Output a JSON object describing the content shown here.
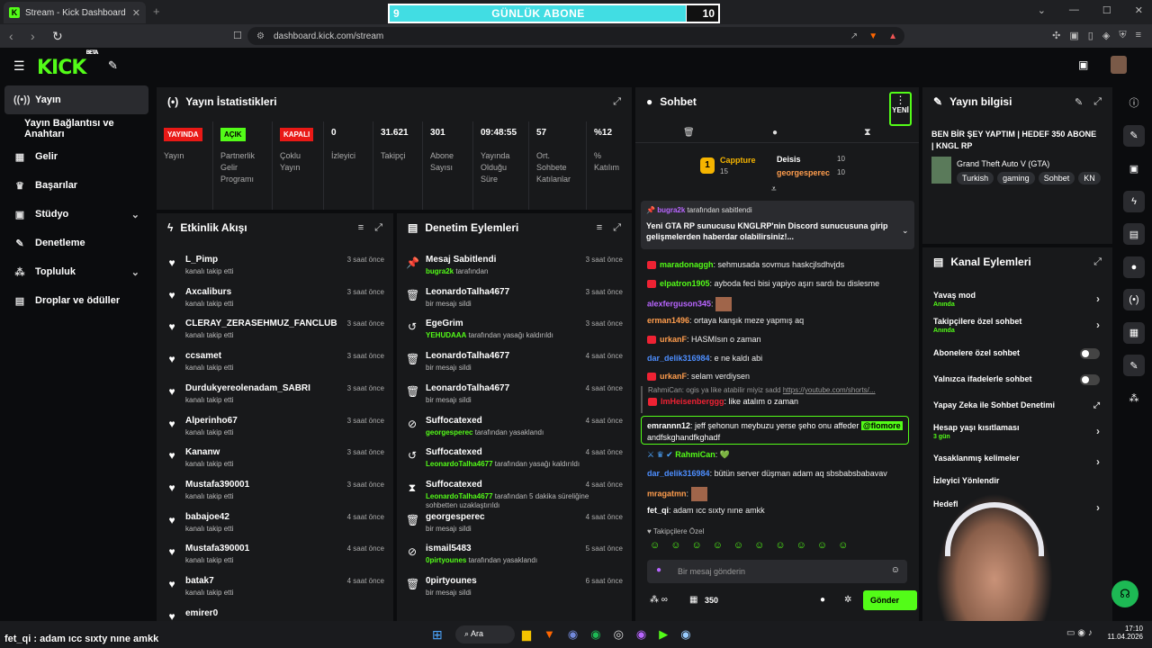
{
  "browser": {
    "tab_title": "Stream - Kick Dashboard",
    "url": "dashboard.kick.com/stream"
  },
  "goal": {
    "current": "9",
    "title": "GÜNLÜK ABONE",
    "target": "10",
    "progress": 0.9
  },
  "app": {
    "logo": "KICK",
    "beta": "BETA"
  },
  "sidebar": {
    "items": [
      {
        "label": "Yayın",
        "icon": "broadcast-icon"
      },
      {
        "label": "Yayın Bağlantısı ve Anahtarı",
        "icon": ""
      },
      {
        "label": "Gelir",
        "icon": "money-icon"
      },
      {
        "label": "Başarılar",
        "icon": "trophy-icon"
      },
      {
        "label": "Stüdyo",
        "icon": "studio-icon"
      },
      {
        "label": "Denetleme",
        "icon": "wrench-icon"
      },
      {
        "label": "Topluluk",
        "icon": "users-icon"
      },
      {
        "label": "Droplar ve ödüller",
        "icon": "gift-icon"
      }
    ]
  },
  "stats": {
    "title": "Yayın İstatistikleri",
    "items": [
      {
        "badge": "YAYINDA",
        "badge_color": "#e91916",
        "label": "Yayın"
      },
      {
        "badge": "AÇIK",
        "badge_color": "#53fc18",
        "label": "Partnerlik Gelir Programı"
      },
      {
        "badge": "KAPALI",
        "badge_color": "#e91916",
        "label": "Çoklu Yayın"
      },
      {
        "value": "0",
        "label": "İzleyici"
      },
      {
        "value": "31.621",
        "label": "Takipçi"
      },
      {
        "value": "301",
        "label": "Abone Sayısı"
      },
      {
        "value": "09:48:55",
        "label": "Yayında Olduğu Süre"
      },
      {
        "value": "57",
        "label": "Ort. Sohbete Katılanlar"
      },
      {
        "value": "%12",
        "label": "% Katılım"
      }
    ]
  },
  "activity": {
    "title": "Etkinlik Akışı",
    "rows": [
      {
        "name": "L_Pimp",
        "desc": "kanalı takip etti",
        "time": "3 saat önce"
      },
      {
        "name": "Axcaliburs",
        "desc": "kanalı takip etti",
        "time": "3 saat önce"
      },
      {
        "name": "CLERAY_ZERASEHMUZ_FANCLUB",
        "desc": "kanalı takip etti",
        "time": "3 saat önce"
      },
      {
        "name": "ccsamet",
        "desc": "kanalı takip etti",
        "time": "3 saat önce"
      },
      {
        "name": "Durdukyereolenadam_SABRI",
        "desc": "kanalı takip etti",
        "time": "3 saat önce"
      },
      {
        "name": "Alperinho67",
        "desc": "kanalı takip etti",
        "time": "3 saat önce"
      },
      {
        "name": "Kananw",
        "desc": "kanalı takip etti",
        "time": "3 saat önce"
      },
      {
        "name": "Mustafa390001",
        "desc": "kanalı takip etti",
        "time": "3 saat önce"
      },
      {
        "name": "babajoe42",
        "desc": "kanalı takip etti",
        "time": "4 saat önce"
      },
      {
        "name": "Mustafa390001",
        "desc": "kanalı takip etti",
        "time": "4 saat önce"
      },
      {
        "name": "batak7",
        "desc": "kanalı takip etti",
        "time": "4 saat önce"
      },
      {
        "name": "emirer0",
        "desc": "",
        "time": ""
      }
    ]
  },
  "mod": {
    "title": "Denetim Eylemleri",
    "rows": [
      {
        "name": "Mesaj Sabitlendi",
        "who": "bugra2k",
        "desc": "tarafından",
        "time": "3 saat önce",
        "icon": "pin-icon"
      },
      {
        "name": "LeonardoTalha4677",
        "who": "",
        "desc": "bir mesajı sildi",
        "time": "3 saat önce",
        "icon": "trash-icon"
      },
      {
        "name": "EgeGrim",
        "who": "YEHUDAAA",
        "desc": "tarafından yasağı kaldırıldı",
        "time": "3 saat önce",
        "icon": "undo-icon"
      },
      {
        "name": "LeonardoTalha4677",
        "who": "",
        "desc": "bir mesajı sildi",
        "time": "4 saat önce",
        "icon": "trash-icon"
      },
      {
        "name": "LeonardoTalha4677",
        "who": "",
        "desc": "bir mesajı sildi",
        "time": "4 saat önce",
        "icon": "trash-icon"
      },
      {
        "name": "Suffocatexed",
        "who": "georgesperec",
        "desc": "tarafından yasaklandı",
        "time": "4 saat önce",
        "icon": "ban-icon"
      },
      {
        "name": "Suffocatexed",
        "who": "LeonardoTalha4677",
        "desc": "tarafından yasağı kaldırıldı",
        "time": "4 saat önce",
        "icon": "undo-icon"
      },
      {
        "name": "Suffocatexed",
        "who": "LeonardoTalha4677",
        "desc": "tarafından 5 dakika süreliğine sohbetten uzaklaştırıldı",
        "time": "4 saat önce",
        "icon": "hourglass-icon"
      },
      {
        "name": "georgesperec",
        "who": "",
        "desc": "bir mesajı sildi",
        "time": "4 saat önce",
        "icon": "trash-icon"
      },
      {
        "name": "ismail5483",
        "who": "0pirtyounes",
        "desc": "tarafından yasaklandı",
        "time": "5 saat önce",
        "icon": "ban-icon"
      },
      {
        "name": "0pirtyounes",
        "who": "",
        "desc": "bir mesajı sildi",
        "time": "6 saat önce",
        "icon": "trash-icon"
      }
    ]
  },
  "chat": {
    "title": "Sohbet",
    "new_label": "YENİ",
    "leaders": {
      "first": {
        "name": "Cappture",
        "count": "15"
      },
      "second": {
        "name": "Deisis",
        "count": "10"
      },
      "third": {
        "name": "georgesperec",
        "count": "10"
      },
      "rank": "1"
    },
    "pinned": {
      "by": "bugra2k",
      "by_suffix": "tarafından sabitlendi",
      "text": "Yeni GTA RP sunucusu KNGLRP'nin Discord sunucusuna girip gelişmelerden haberdar olabilirsiniz!..."
    },
    "messages": [
      {
        "user": "maradonaggh",
        "color": "#53fc18",
        "text": "sehmusada sovmus haskcjlsdhvjds",
        "badge": true
      },
      {
        "user": "elpatron1905",
        "color": "#53fc18",
        "text": "ayboda feci bisi yapiyo aşırı sardı bu dislesme",
        "badge": true
      },
      {
        "user": "alexferguson345",
        "color": "#b865ff",
        "text": "",
        "badge": false,
        "emote": true
      },
      {
        "user": "erman1496",
        "color": "#ff9d4d",
        "text": "ortaya kanşık meze yapmış aq",
        "badge": false
      },
      {
        "user": "urkanF",
        "color": "#ff9d4d",
        "text": "HASMIsın o zaman",
        "badge": true
      },
      {
        "user": "dar_delik316984",
        "color": "#4d8eff",
        "text": "e ne kaldı abi",
        "badge": false
      },
      {
        "user": "urkanF",
        "color": "#ff9d4d",
        "text": "selam verdiysen",
        "badge": true
      }
    ],
    "reply": {
      "quote": "RahmiCan: ogis ya like atabilir miyiz sadd",
      "link": "https://youtube.com/shorts/...",
      "user": "ImHeisenberggg",
      "text": "like atalım o zaman"
    },
    "highlight": {
      "user": "emrannn12",
      "text": "jeff şehonun meybuzu yerse şeho onu affeder",
      "mention": "@flomore",
      "text2": "andfskghandfkghadf"
    },
    "rahmi": {
      "user": "RahmiCan",
      "text": "💚"
    },
    "after": [
      {
        "user": "dar_delik316984",
        "color": "#4d8eff",
        "text": "bütün server düşman adam aq sbsbabsbabavav"
      },
      {
        "user": "mragatmn",
        "color": "#ff9d4d",
        "text": ""
      },
      {
        "user": "fet_qi",
        "color": "#ffffff",
        "text": "adam ıcc sıxty nıne amkk"
      }
    ],
    "followers_only": "Takipçilere Özel",
    "input_placeholder": "Bir mesaj gönderin",
    "points": "350",
    "send": "Gönder"
  },
  "info": {
    "title": "Yayın bilgisi",
    "stream_title": "BEN BİR ŞEY YAPTIM | HEDEF 350 ABONE | KNGL RP",
    "game": "Grand Theft Auto V (GTA)",
    "tags": [
      "Turkish",
      "gaming",
      "Sohbet",
      "KN"
    ]
  },
  "channel": {
    "title": "Kanal Eylemleri",
    "items": [
      {
        "label": "Yavaş mod",
        "sub": "Anında",
        "type": "chevron"
      },
      {
        "label": "Takipçilere özel sohbet",
        "sub": "Anında",
        "type": "chevron"
      },
      {
        "label": "Abonelere özel sohbet",
        "sub": "",
        "type": "toggle"
      },
      {
        "label": "Yalnızca ifadelerle sohbet",
        "sub": "",
        "type": "toggle"
      },
      {
        "label": "Yapay Zeka ile Sohbet Denetimi",
        "sub": "",
        "type": "external"
      },
      {
        "label": "Hesap yaşı kısıtlaması",
        "sub": "3 gün",
        "type": "chevron"
      },
      {
        "label": "Yasaklanmış kelimeler",
        "sub": "",
        "type": "chevron"
      },
      {
        "label": "İzleyici Yönlendir",
        "sub": "",
        "type": "none"
      },
      {
        "label": "Hedefl",
        "sub": "",
        "type": "chevron"
      }
    ]
  },
  "taskbar": {
    "search": "Ara",
    "time": "17:10",
    "date": "11.04.2026"
  },
  "ticker": "fet_qi : adam ıcc sıxty nıne amkk",
  "colors": {
    "kick_green": "#53fc18",
    "panel": "#18191b",
    "bg": "#0b0c0e",
    "live_red": "#e91916"
  }
}
